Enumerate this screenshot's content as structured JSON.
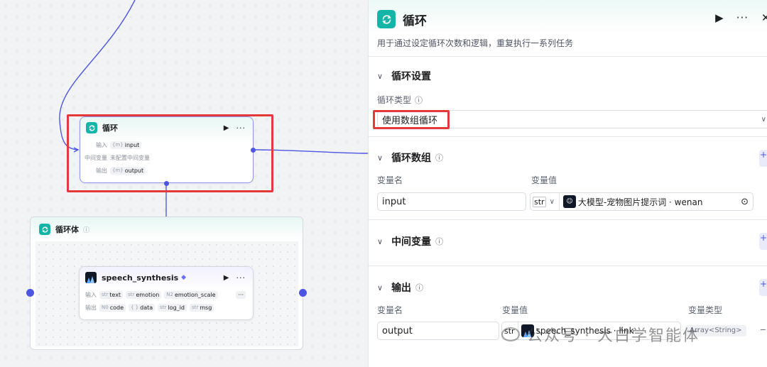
{
  "canvas": {
    "loop_node": {
      "title": "循环",
      "inputs_label": "输入",
      "input_type": "{m}",
      "input_name": "input",
      "mid_label": "中间变量",
      "mid_value": "未配置中间变量",
      "outputs_label": "输出",
      "output_type": "{m}",
      "output_name": "output"
    },
    "loop_body": {
      "title": "循环体"
    },
    "speech_node": {
      "title": "speech_synthesis",
      "inputs_label": "输入",
      "inputs": [
        {
          "type": "str",
          "name": "text"
        },
        {
          "type": "str",
          "name": "emotion"
        },
        {
          "type": "N2",
          "name": "emotion_scale"
        }
      ],
      "outputs_label": "输出",
      "outputs": [
        {
          "type": "N0",
          "name": "code"
        },
        {
          "type": "{ }",
          "name": "data"
        },
        {
          "type": "str",
          "name": "log_id"
        },
        {
          "type": "str",
          "name": "msg"
        }
      ]
    }
  },
  "panel": {
    "title": "循环",
    "description": "用于通过设定循环次数和逻辑，重复执行一系列任务",
    "settings": {
      "heading": "循环设置",
      "type_label": "循环类型",
      "type_value": "使用数组循环"
    },
    "array": {
      "heading": "循环数组",
      "col_name": "变量名",
      "col_value": "变量值",
      "var_name": "input",
      "var_type": "str",
      "ref_text": "大模型-宠物图片提示词 · wenan"
    },
    "middle": {
      "heading": "中间变量"
    },
    "output": {
      "heading": "输出",
      "col_name": "变量名",
      "col_value": "变量值",
      "col_type": "变量类型",
      "var_name": "output",
      "var_type": "str",
      "ref_text": "speech_synthesis · link",
      "type_value": "Array<String>"
    }
  },
  "watermark": "公众号 · 大白学智能体",
  "colors": {
    "accent": "#4c56e0",
    "loop_icon": "#12b5a8",
    "highlight": "#e5383b"
  }
}
